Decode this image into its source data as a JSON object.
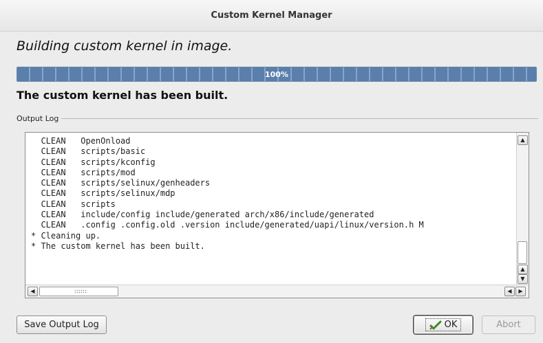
{
  "window": {
    "title": "Custom Kernel Manager"
  },
  "heading": "Building custom kernel in image.",
  "progress": {
    "value": 1.0,
    "label": "100%"
  },
  "status": "The custom kernel has been built.",
  "output_log": {
    "label": "Output Log",
    "lines": [
      "  CLEAN   OpenOnload",
      "  CLEAN   scripts/basic",
      "  CLEAN   scripts/kconfig",
      "  CLEAN   scripts/mod",
      "  CLEAN   scripts/selinux/genheaders",
      "  CLEAN   scripts/selinux/mdp",
      "  CLEAN   scripts",
      "  CLEAN   include/config include/generated arch/x86/include/generated",
      "  CLEAN   .config .config.old .version include/generated/uapi/linux/version.h M",
      "* Cleaning up.",
      "* The custom kernel has been built."
    ]
  },
  "buttons": {
    "save": "Save Output Log",
    "ok": "OK",
    "abort": "Abort"
  },
  "icons": {
    "ok": "checkmark-icon",
    "scroll_up": "arrow-up-icon",
    "scroll_down": "arrow-down-icon",
    "scroll_left": "arrow-left-icon",
    "scroll_right": "arrow-right-icon"
  },
  "colors": {
    "progress": "#5e82ae",
    "ok_check": "#3d8a2a"
  }
}
